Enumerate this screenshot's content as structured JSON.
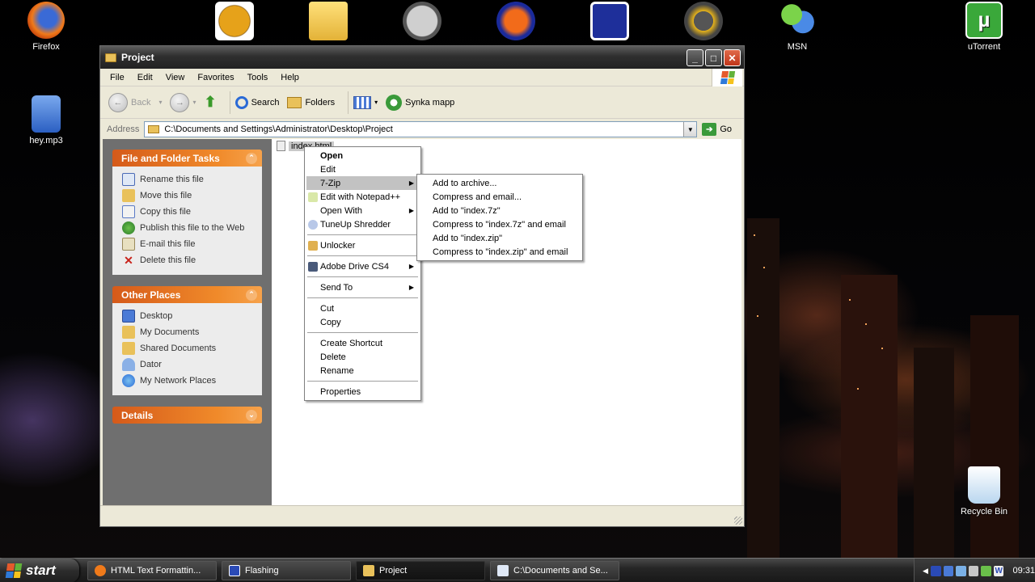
{
  "desktop": {
    "icons": [
      {
        "label": "Firefox"
      },
      {
        "label": "hey.mp3"
      },
      {
        "label": "MSN"
      },
      {
        "label": "uTorrent"
      },
      {
        "label": "Recycle Bin"
      }
    ]
  },
  "window": {
    "title": "Project",
    "controls": {
      "minimize": "_",
      "maximize": "□",
      "close": "✕"
    }
  },
  "menubar": [
    "File",
    "Edit",
    "View",
    "Favorites",
    "Tools",
    "Help"
  ],
  "toolbar": {
    "back": "Back",
    "search": "Search",
    "folders": "Folders",
    "sync": "Synka mapp"
  },
  "address": {
    "label": "Address",
    "path": "C:\\Documents and Settings\\Administrator\\Desktop\\Project",
    "go": "Go"
  },
  "panels": {
    "file_tasks": {
      "title": "File and Folder Tasks",
      "items": [
        "Rename this file",
        "Move this file",
        "Copy this file",
        "Publish this file to the Web",
        "E-mail this file",
        "Delete this file"
      ]
    },
    "other_places": {
      "title": "Other Places",
      "items": [
        "Desktop",
        "My Documents",
        "Shared Documents",
        "Dator",
        "My Network Places"
      ]
    },
    "details": {
      "title": "Details"
    }
  },
  "file": {
    "name": "index.html"
  },
  "context_menu": {
    "items": [
      "Open",
      "Edit",
      "7-Zip",
      "Edit with Notepad++",
      "Open With",
      "TuneUp Shredder",
      "Unlocker",
      "Adobe Drive CS4",
      "Send To",
      "Cut",
      "Copy",
      "Create Shortcut",
      "Delete",
      "Rename",
      "Properties"
    ]
  },
  "submenu_7zip": {
    "items": [
      "Add to archive...",
      "Compress and email...",
      "Add to \"index.7z\"",
      "Compress to \"index.7z\" and email",
      "Add to \"index.zip\"",
      "Compress to \"index.zip\" and email"
    ]
  },
  "taskbar": {
    "start": "start",
    "items": [
      "HTML Text Formattin...",
      "Flashing",
      "Project",
      "C:\\Documents and Se..."
    ],
    "clock": "09:31"
  }
}
